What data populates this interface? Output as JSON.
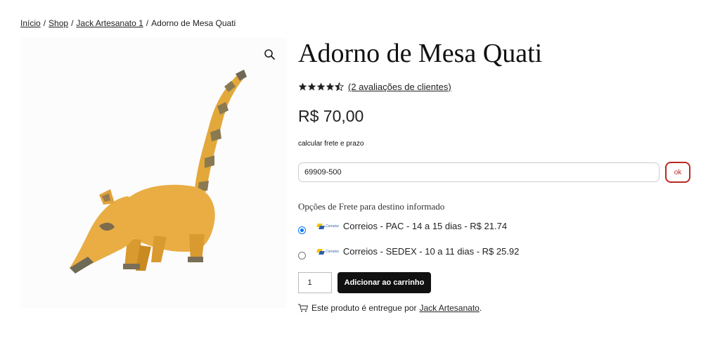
{
  "breadcrumb": {
    "items": [
      "Início",
      "Shop",
      "Jack Artesanato 1"
    ],
    "current": "Adorno de Mesa Quati",
    "separator": "/"
  },
  "product": {
    "title": "Adorno de Mesa Quati",
    "rating": 4.5,
    "rating_max": 5,
    "reviews_link": "(2 avaliações de clientes)",
    "price": "R$ 70,00",
    "image_icon": "coati-figurine-image"
  },
  "shipping": {
    "label": "calcular frete e prazo",
    "cep_value": "69909-500",
    "ok_label": "ok",
    "accent_color": "#b82a24",
    "options_title": "Opções de Frete para destino informado",
    "logo_text": "Correios",
    "options": [
      {
        "label": "Correios - PAC - 14 a 15 dias - R$ 21.74",
        "selected": true
      },
      {
        "label": "Correios - SEDEX - 10 a 11 dias - R$ 25.92",
        "selected": false
      }
    ]
  },
  "cart": {
    "quantity": "1",
    "add_label": "Adicionar ao carrinho"
  },
  "vendor": {
    "text": "Este produto é entregue por",
    "name": "Jack Artesanato",
    "suffix": "."
  }
}
